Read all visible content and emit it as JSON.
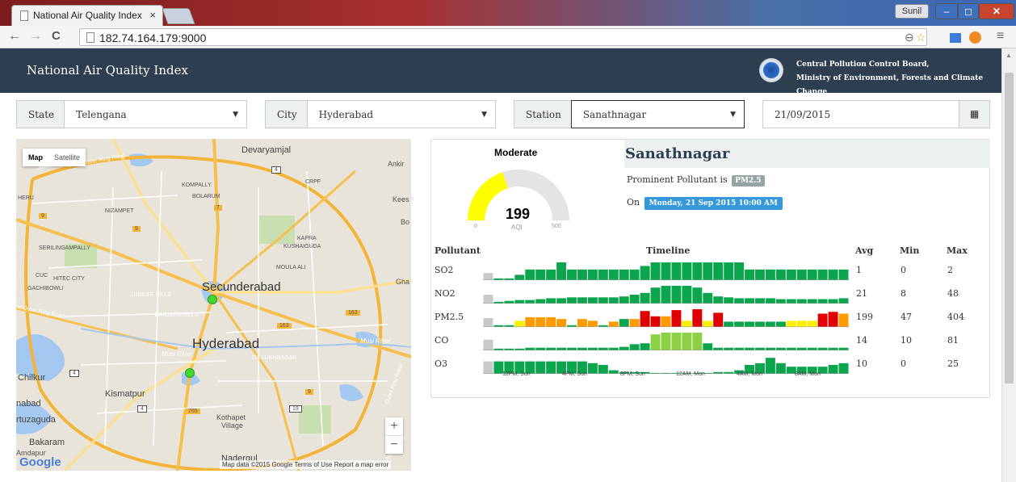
{
  "browser": {
    "tab_title": "National Air Quality Index",
    "tab_close": "×",
    "url": "182.74.164.179:9000",
    "user": "Sunil",
    "back": "←",
    "forward": "→",
    "reload": "C",
    "menu": "≡",
    "zoom_icon": "⊖",
    "star_icon": "☆"
  },
  "header": {
    "title": "National Air Quality Index",
    "org_line1": "Central Pollution Control Board,",
    "org_line2": "Ministry of Environment, Forests and Climate Change"
  },
  "filters": {
    "state": {
      "label": "State",
      "value": "Telengana"
    },
    "city": {
      "label": "City",
      "value": "Hyderabad"
    },
    "station": {
      "label": "Station",
      "value": "Sanathnagar"
    },
    "date": "21/09/2015"
  },
  "map": {
    "toggle_map": "Map",
    "toggle_satellite": "Satellite",
    "labels": {
      "secunderabad": "Secunderabad",
      "hyderabad": "Hyderabad",
      "devaryamjal": "Devaryamjal",
      "ankira": "Ankir",
      "kompally": "KOMPALLY",
      "bolarum": "BOLARUM",
      "nizampet": "NIZAMPET",
      "kees": "Kees",
      "bo": "Bo",
      "serilingampally": "SERILINGAMPALLY",
      "kapra": "KAPRA",
      "kushaiguda": "KUSHAIGUDA",
      "moula_ali": "MOULA ALI",
      "hitec_city": "HITEC CITY",
      "cuc": "CUC",
      "gachibowli": "GACHIBOWLI",
      "jubilee_hills": "JUBILEE HILLS",
      "banjara_hills": "BANJARA HILLS",
      "gha": "Gha",
      "musi_river": "Musi River",
      "musi_river2": "Musi River",
      "dilsukhnagar": "DILSUKHNAGAR",
      "chilkur": "Chilkur",
      "kismatpur": "Kismatpur",
      "nabad": "nabad",
      "rtuzaguda": "rtuzaguda",
      "kothapet": "Kothapet",
      "village": "Village",
      "bakaram": "Bakaram",
      "amdapur": "Amdapur",
      "nadergul": "Nadergul",
      "hitec_ring": "Nehru Outer Ring Road",
      "outer_ring": "Nehru Outer Ring Road",
      "crpf": "CRPF",
      "herd": "HERU",
      "jawaharlal": "Jawaharlal",
      "hyderabad_side": "hafal Nehru",
      "ring_road_right": "Outer Ring Road",
      "rahu_outer": "ehru Outer Ring Road",
      "road_9a": "9",
      "road_9b": "9",
      "road_7": "7",
      "road_163a": "163",
      "road_163b": "163",
      "road_4": "4",
      "road_9c": "9",
      "road_4b": "4",
      "road_19": "19",
      "road_765": "765"
    },
    "google": "Google",
    "attribution": "Map data ©2015 Google   Terms of Use   Report a map error",
    "zoom_in": "+",
    "zoom_out": "−"
  },
  "aqi": {
    "category": "Moderate",
    "value": "199",
    "unit_label": "AQI",
    "scale_min": "0",
    "scale_max": "500",
    "fraction": 0.398,
    "color": "#ffff00"
  },
  "station_info": {
    "name": "Sanathnagar",
    "prominent_prefix": "Prominent Pollutant is",
    "prominent_pollutant": "PM2.5",
    "on_prefix": "On",
    "timestamp": "Monday, 21 Sep 2015 10:00 AM"
  },
  "table": {
    "headers": {
      "pollutant": "Pollutant",
      "timeline": "Timeline",
      "avg": "Avg",
      "min": "Min",
      "max": "Max"
    },
    "rows": [
      {
        "name": "SO2",
        "avg": "1",
        "min": "0",
        "max": "2",
        "bars": [
          0.4,
          0.1,
          0.1,
          0.3,
          0.6,
          0.6,
          0.6,
          1,
          0.6,
          0.6,
          0.6,
          0.6,
          0.6,
          0.6,
          0.6,
          0.8,
          1,
          1,
          1,
          1,
          1,
          1,
          1,
          1,
          1,
          0.6,
          0.6,
          0.6,
          0.6,
          0.6,
          0.6,
          0.6,
          0.6,
          0.6,
          0.6
        ],
        "colors": [
          "g"
        ]
      },
      {
        "name": "NO2",
        "avg": "21",
        "min": "8",
        "max": "48",
        "bars": [
          0.5,
          0.1,
          0.15,
          0.2,
          0.2,
          0.25,
          0.3,
          0.3,
          0.35,
          0.35,
          0.35,
          0.35,
          0.35,
          0.4,
          0.5,
          0.6,
          0.9,
          1,
          1,
          1,
          0.9,
          0.6,
          0.4,
          0.35,
          0.3,
          0.3,
          0.3,
          0.3,
          0.25,
          0.25,
          0.25,
          0.25,
          0.25,
          0.25,
          0.3
        ],
        "colors": [
          "g"
        ]
      },
      {
        "name": "PM2.5",
        "avg": "199",
        "min": "47",
        "max": "404",
        "bars": [
          0.5,
          0.1,
          0.1,
          0.35,
          0.55,
          0.55,
          0.55,
          0.45,
          0.1,
          0.45,
          0.35,
          0.1,
          0.3,
          0.45,
          0.45,
          0.9,
          0.6,
          0.6,
          0.95,
          0.35,
          1,
          0.35,
          0.8,
          0.3,
          0.3,
          0.3,
          0.3,
          0.3,
          0.3,
          0.35,
          0.35,
          0.35,
          0.75,
          0.85,
          0.75
        ],
        "colors": [
          "x",
          "g",
          "g",
          "y",
          "o",
          "o",
          "o",
          "o",
          "g",
          "o",
          "o",
          "g",
          "o",
          "g",
          "o",
          "r",
          "r",
          "o",
          "r",
          "y",
          "r",
          "y",
          "r",
          "g",
          "g",
          "g",
          "g",
          "g",
          "g",
          "y",
          "y",
          "y",
          "r",
          "r",
          "o"
        ]
      },
      {
        "name": "CO",
        "avg": "14",
        "min": "10",
        "max": "81",
        "bars": [
          0.6,
          0.1,
          0.1,
          0.1,
          0.15,
          0.15,
          0.15,
          0.15,
          0.15,
          0.15,
          0.15,
          0.15,
          0.15,
          0.2,
          0.35,
          0.4,
          0.9,
          1,
          1,
          1,
          1,
          0.4,
          0.15,
          0.15,
          0.15,
          0.15,
          0.15,
          0.15,
          0.15,
          0.15,
          0.15,
          0.15,
          0.15,
          0.15,
          0.15
        ],
        "colors": [
          "x",
          "g",
          "g",
          "g",
          "g",
          "g",
          "g",
          "g",
          "g",
          "g",
          "g",
          "g",
          "g",
          "g",
          "g",
          "g",
          "l",
          "l",
          "l",
          "l",
          "l",
          "g",
          "g",
          "g",
          "g",
          "g",
          "g",
          "g",
          "g",
          "g",
          "g",
          "g",
          "g",
          "g",
          "g"
        ]
      },
      {
        "name": "O3",
        "avg": "10",
        "min": "0",
        "max": "25",
        "bars": [
          0.7,
          0.7,
          0.7,
          0.7,
          0.7,
          0.7,
          0.7,
          0.7,
          0.7,
          0.7,
          0.6,
          0.5,
          0.2,
          0.1,
          0.1,
          0.1,
          0.05,
          0.05,
          0.05,
          0.05,
          0.05,
          0.05,
          0.1,
          0.1,
          0.2,
          0.5,
          0.6,
          0.9,
          0.6,
          0.4,
          0.4,
          0.4,
          0.4,
          0.5,
          0.6
        ],
        "colors": [
          "x",
          "g"
        ]
      }
    ],
    "time_labels": [
      "12PM, Sun",
      "4PM, Sun",
      "8PM, Sun",
      "12AM, Mon",
      "4AM, Mon",
      "8AM, Mon"
    ]
  },
  "colors": {
    "header_bg": "#2c3e50",
    "good_green": "#0ba54e",
    "light_green": "#8cd045",
    "yellow": "#ffee00",
    "orange": "#ff9a00",
    "red": "#e00000",
    "grey": "#c9c9c9",
    "info_blue": "#3498db"
  }
}
